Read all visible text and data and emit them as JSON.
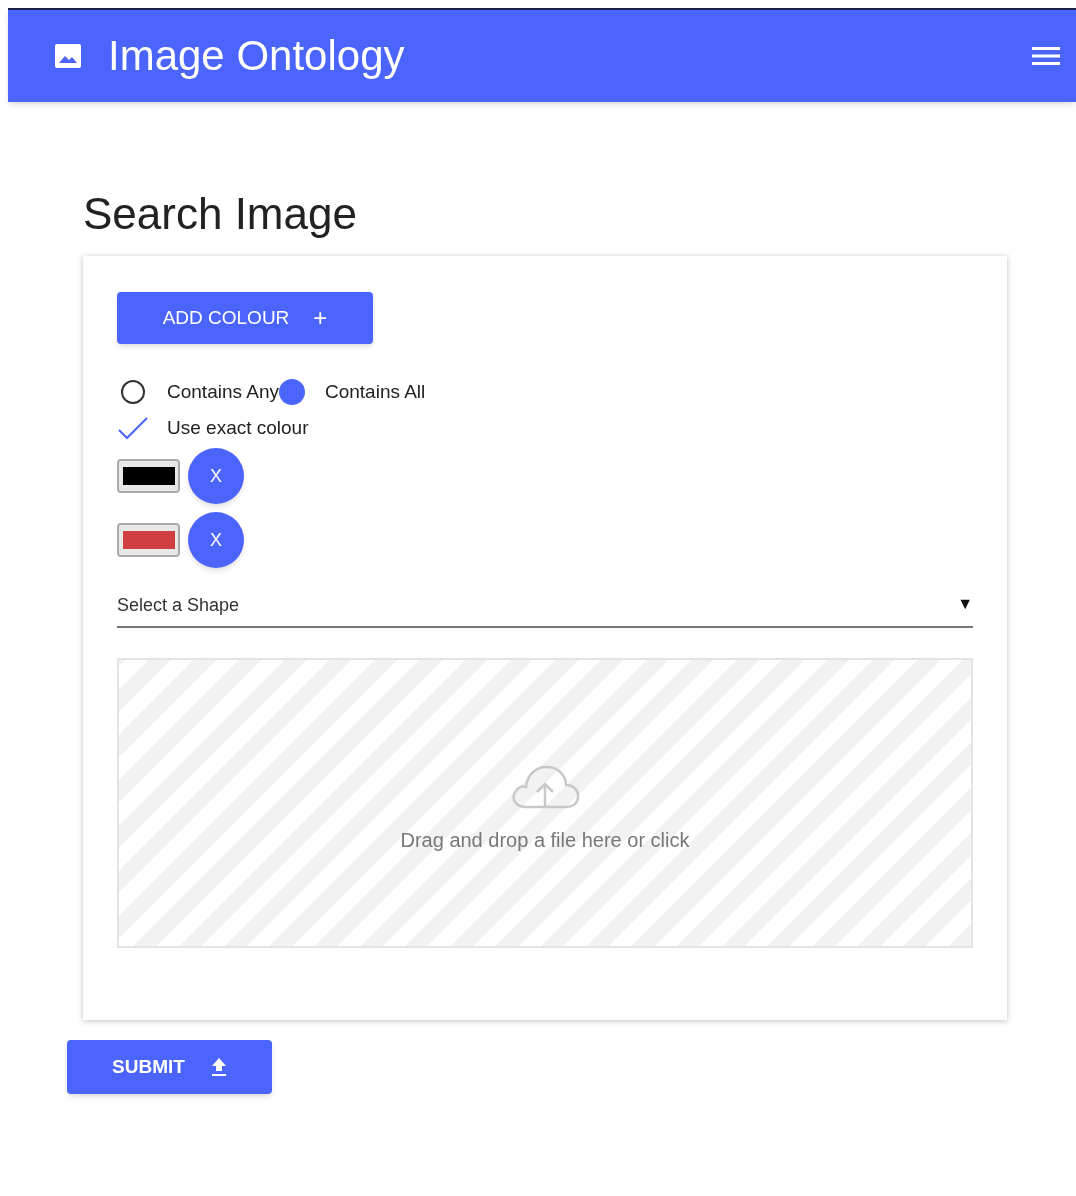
{
  "app_bar": {
    "title": "Image Ontology"
  },
  "page": {
    "heading": "Search Image"
  },
  "form": {
    "add_button": {
      "label": "ADD COLOUR",
      "icon_text": "+"
    },
    "match_mode": [
      {
        "label": "Contains Any",
        "selected": false
      },
      {
        "label": "Contains All",
        "selected": true
      }
    ],
    "exact_colour": {
      "label": "Use exact colour",
      "checked": true
    },
    "colours": [
      {
        "color": "#000000",
        "remove_label": "X"
      },
      {
        "color": "#d04040",
        "remove_label": "X"
      }
    ],
    "shape_select": {
      "placeholder": "Select a Shape",
      "arrow": "▼"
    },
    "dropzone": {
      "text": "Drag and drop a file here or click"
    }
  },
  "submit": {
    "label": "SUBMIT"
  }
}
